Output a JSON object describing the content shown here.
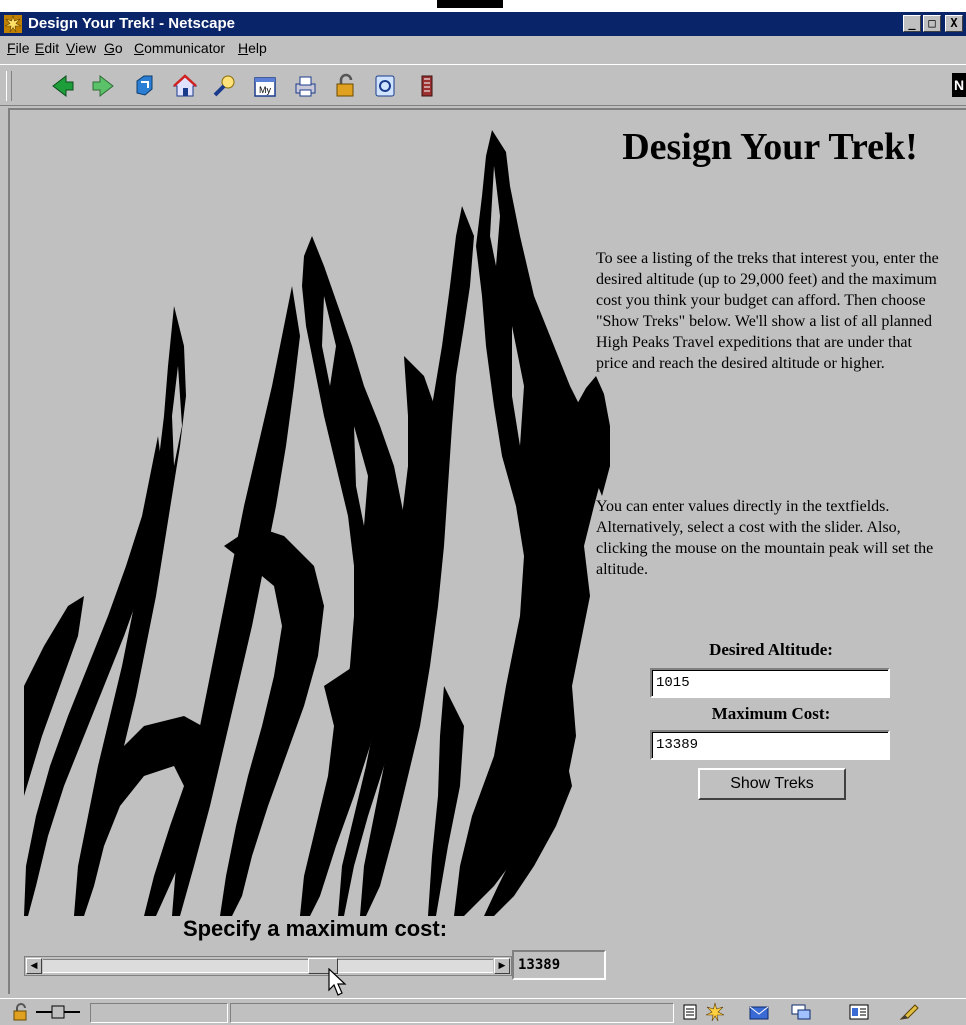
{
  "window": {
    "title": "Design Your Trek! - Netscape",
    "controls": [
      "_",
      "□",
      "X"
    ]
  },
  "menu": [
    {
      "label": "File",
      "key": "F",
      "rest": "ile"
    },
    {
      "label": "Edit",
      "key": "E",
      "rest": "dit"
    },
    {
      "label": "View",
      "key": "V",
      "rest": "iew"
    },
    {
      "label": "Go",
      "key": "G",
      "rest": "o"
    },
    {
      "label": "Communicator",
      "key": "C",
      "rest": "ommunicator"
    },
    {
      "label": "Help",
      "key": "H",
      "rest": "elp"
    }
  ],
  "toolbar": {
    "buttons": [
      "back-icon",
      "forward-icon",
      "reload-icon",
      "home-icon",
      "search-icon",
      "my-netscape-icon",
      "print-icon",
      "security-icon",
      "shop-icon",
      "stop-icon"
    ],
    "my_label": "My",
    "logo": "N"
  },
  "page": {
    "heading": "Design Your Trek!",
    "paragraph1": "To see a listing of the treks that interest you, enter the desired altitude (up to 29,000 feet) and the maximum cost you think your budget can afford. Then choose \"Show Treks\" below. We'll show a list of all planned High Peaks Travel expeditions that are under that price and reach the desired altitude or higher.",
    "paragraph2": "You can enter values directly in the textfields. Alternatively, select a cost with the slider. Also, clicking the mouse on the mountain peak will set the altitude.",
    "altitude_label": "Desired Altitude:",
    "altitude_value": "1015",
    "cost_label": "Maximum Cost:",
    "cost_value": "13389",
    "show_button": "Show Treks",
    "slider_caption": "Specify a maximum cost:",
    "slider_value": "13389",
    "slider_position": 0.63
  },
  "colors": {
    "window_bg": "#c0c0c0",
    "titlebar": "#0a246a",
    "ink": "#000000"
  }
}
